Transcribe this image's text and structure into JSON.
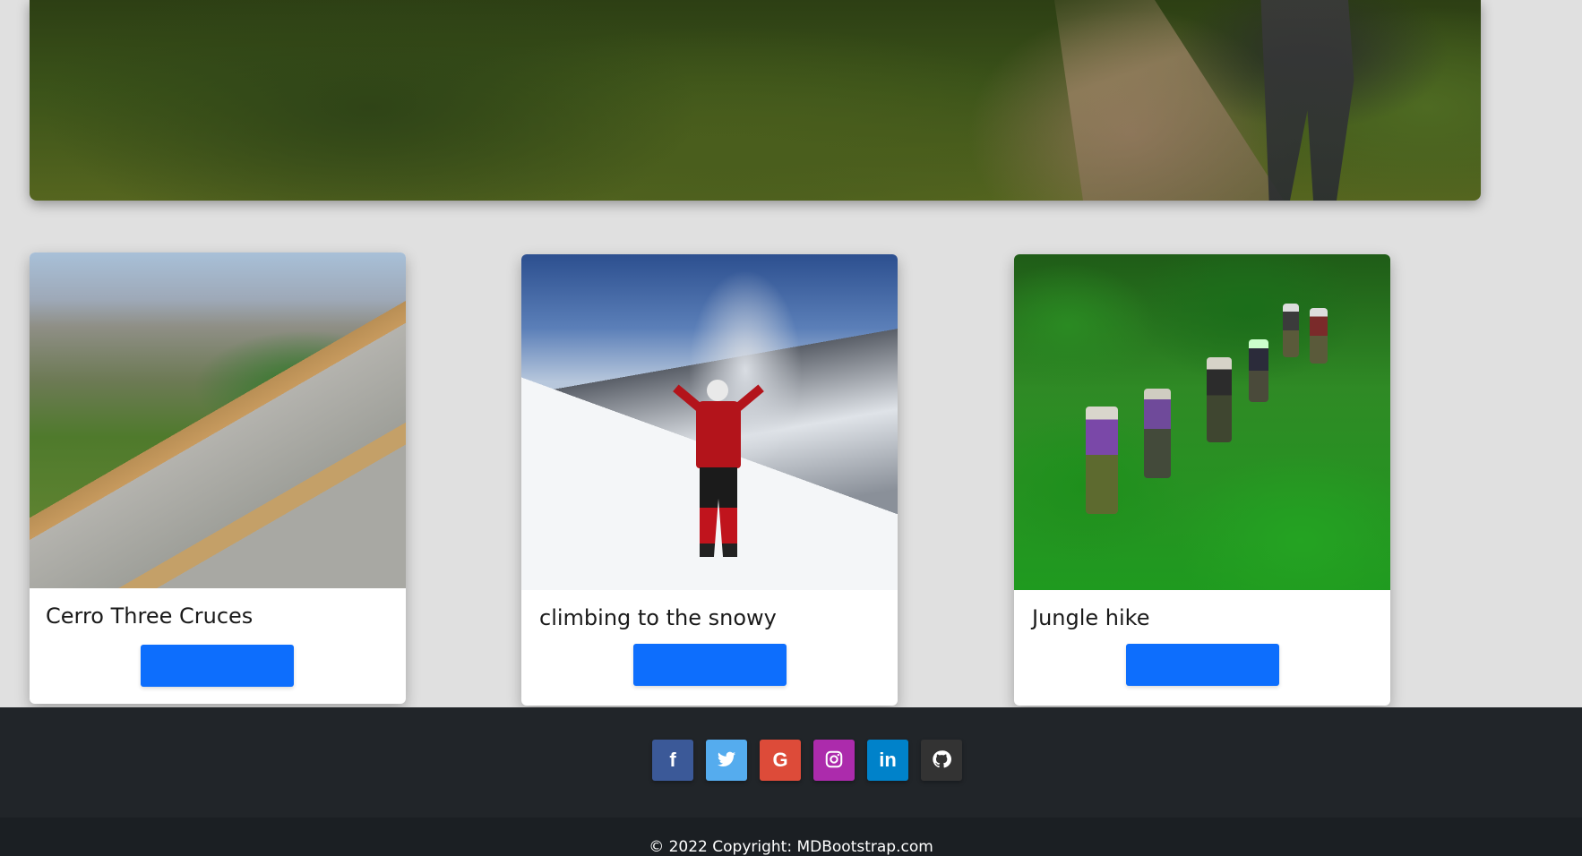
{
  "hero": {
    "image_alt": "hiker-on-mountain-trail"
  },
  "cards": [
    {
      "title": "Cerro Three Cruces",
      "button_label": "",
      "image": "cerro-three-cruces-photo"
    },
    {
      "title": "climbing to the snowy",
      "button_label": "",
      "image": "snowy-mountain-climber-photo"
    },
    {
      "title": "Jungle hike",
      "button_label": "",
      "image": "jungle-hikers-photo"
    }
  ],
  "footer": {
    "social": [
      {
        "name": "facebook",
        "icon": "facebook-icon",
        "glyph": "f",
        "color": "#3b5998"
      },
      {
        "name": "twitter",
        "icon": "twitter-icon",
        "glyph": "",
        "color": "#55acee"
      },
      {
        "name": "google",
        "icon": "google-icon",
        "glyph": "G",
        "color": "#dd4b39"
      },
      {
        "name": "instagram",
        "icon": "instagram-icon",
        "glyph": "",
        "color": "#ac2bac"
      },
      {
        "name": "linkedin",
        "icon": "linkedin-icon",
        "glyph": "in",
        "color": "#0082ca"
      },
      {
        "name": "github",
        "icon": "github-icon",
        "glyph": "",
        "color": "#333333"
      }
    ],
    "copyright": "© 2022 Copyright: MDBootstrap.com"
  },
  "colors": {
    "page_bg": "#e0e0e0",
    "button": "#0d6efd",
    "footer_top": "#212529",
    "footer_bottom": "#1b1f23"
  }
}
